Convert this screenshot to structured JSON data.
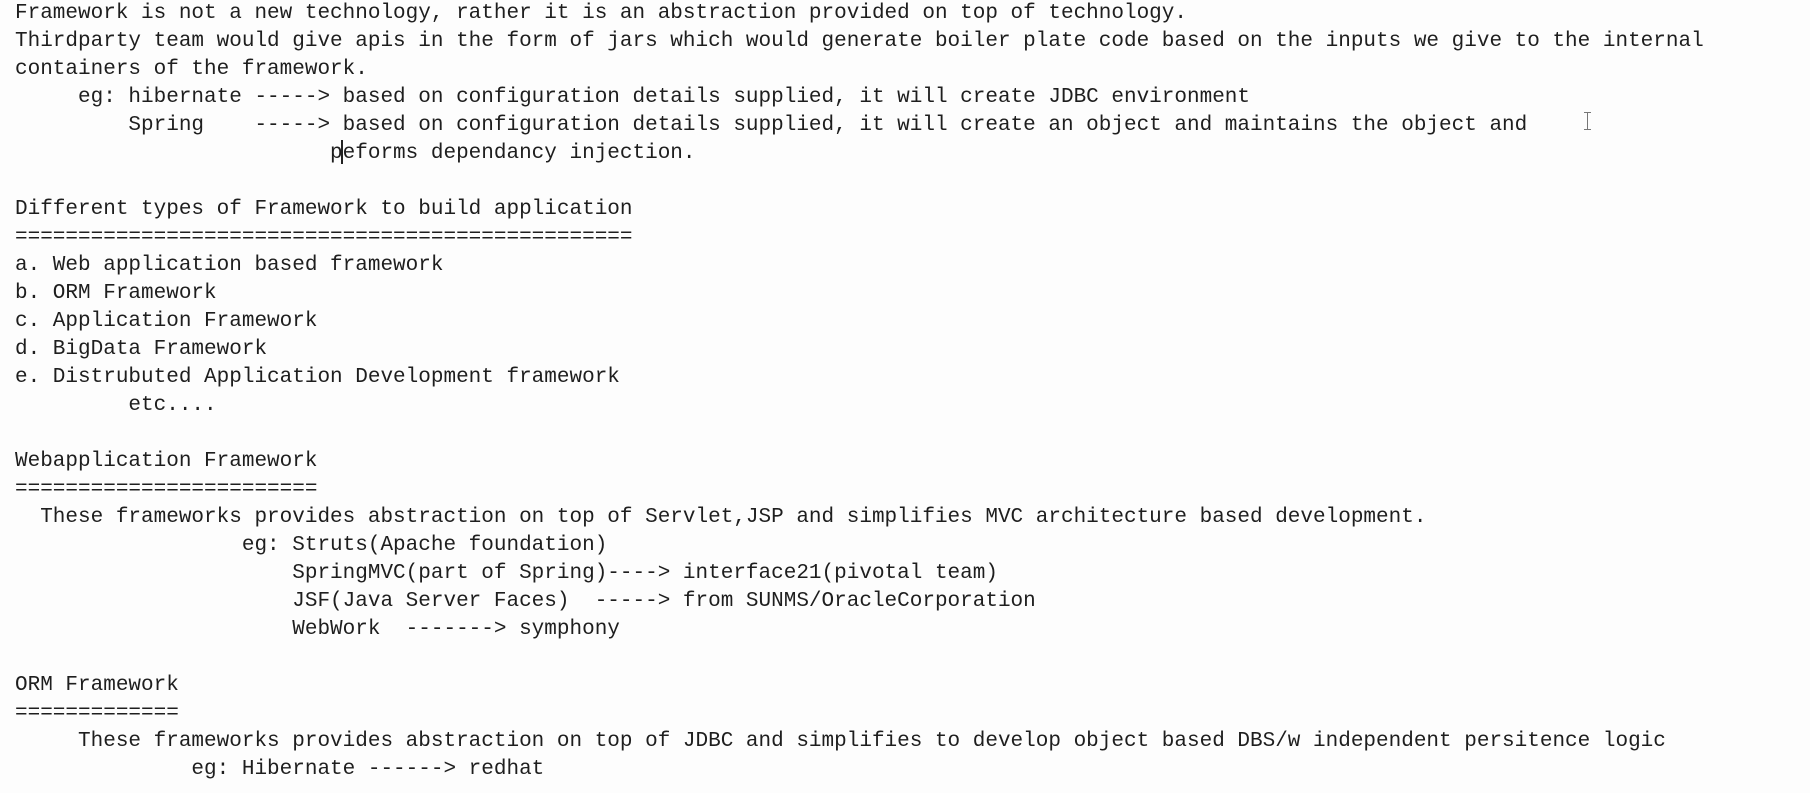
{
  "document": {
    "lines": [
      "Framework is not a new technology, rather it is an abstraction provided on top of technology.",
      "Thirdparty team would give apis in the form of jars which would generate boiler plate code based on the inputs we give to the internal",
      "containers of the framework.",
      "     eg: hibernate -----> based on configuration details supplied, it will create JDBC environment",
      "         Spring    -----> based on configuration details supplied, it will create an object and maintains the object and",
      "                         peforms dependancy injection.",
      "",
      "Different types of Framework to build application",
      "=================================================",
      "a. Web application based framework",
      "b. ORM Framework",
      "c. Application Framework",
      "d. BigData Framework",
      "e. Distrubuted Application Development framework",
      "         etc....",
      "",
      "Webapplication Framework",
      "========================",
      "  These frameworks provides abstraction on top of Servlet,JSP and simplifies MVC architecture based development.",
      "                  eg: Struts(Apache foundation)",
      "                      SpringMVC(part of Spring)----> interface21(pivotal team)",
      "                      JSF(Java Server Faces)  -----> from SUNMS/OracleCorporation",
      "                      WebWork  -------> symphony",
      "",
      "ORM Framework",
      "=============",
      "     These frameworks provides abstraction on top of JDBC and simplifies to develop object based DBS/w independent persitence logic",
      "              eg: Hibernate ------> redhat"
    ]
  }
}
